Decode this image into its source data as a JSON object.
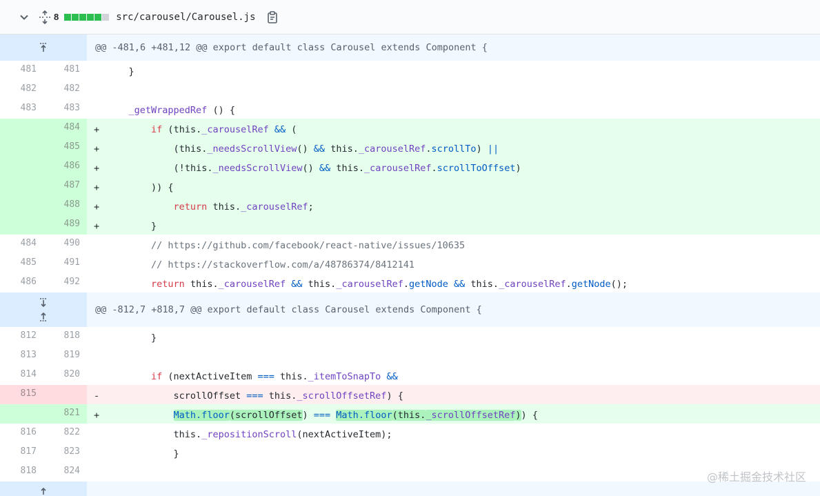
{
  "file": {
    "stat_count": "8",
    "stat_colors": [
      "#2cbe4e",
      "#2cbe4e",
      "#2cbe4e",
      "#2cbe4e",
      "#2cbe4e",
      "#d1d5da"
    ],
    "path": "src/carousel/Carousel.js",
    "icons": {
      "collapse": "chevron-down-icon",
      "expand": "unfold-icon",
      "copy": "clipboard-icon"
    }
  },
  "hunks": [
    {
      "header": "@@ -481,6 +481,12 @@ export default class Carousel extends Component {"
    },
    {
      "header": "@@ -812,7 +818,7 @@ export default class Carousel extends Component {"
    }
  ],
  "lines": [
    {
      "old": "481",
      "new": "481",
      "marker": ""
    },
    {
      "old": "482",
      "new": "482",
      "marker": ""
    },
    {
      "old": "483",
      "new": "483",
      "marker": ""
    },
    {
      "old": "",
      "new": "484",
      "marker": "+"
    },
    {
      "old": "",
      "new": "485",
      "marker": "+"
    },
    {
      "old": "",
      "new": "486",
      "marker": "+"
    },
    {
      "old": "",
      "new": "487",
      "marker": "+"
    },
    {
      "old": "",
      "new": "488",
      "marker": "+"
    },
    {
      "old": "",
      "new": "489",
      "marker": "+"
    },
    {
      "old": "484",
      "new": "490",
      "marker": ""
    },
    {
      "old": "485",
      "new": "491",
      "marker": ""
    },
    {
      "old": "486",
      "new": "492",
      "marker": ""
    },
    {
      "old": "812",
      "new": "818",
      "marker": ""
    },
    {
      "old": "813",
      "new": "819",
      "marker": ""
    },
    {
      "old": "814",
      "new": "820",
      "marker": ""
    },
    {
      "old": "815",
      "new": "",
      "marker": "-"
    },
    {
      "old": "",
      "new": "821",
      "marker": "+"
    },
    {
      "old": "816",
      "new": "822",
      "marker": ""
    },
    {
      "old": "817",
      "new": "823",
      "marker": ""
    },
    {
      "old": "818",
      "new": "824",
      "marker": ""
    }
  ],
  "code": {
    "l0": {
      "indent": "    ",
      "t": "}"
    },
    "l2": {
      "indent": "    ",
      "fn": "_getWrappedRef",
      "t": " () {"
    },
    "l3": {
      "indent": "        ",
      "kw": "if",
      "a": " (",
      "this": "this",
      "dot": ".",
      "fn": "_carouselRef",
      "op": " &&",
      "b": " ("
    },
    "l4": {
      "indent": "            ",
      "a": "(",
      "this1": "this",
      "d1": ".",
      "fn1": "_needsScrollView",
      "b": "() ",
      "op1": "&&",
      "c": " ",
      "this2": "this",
      "d2": ".",
      "fn2": "_carouselRef",
      "d3": ".",
      "prop": "scrollTo",
      "e": ") ",
      "op2": "||"
    },
    "l5": {
      "indent": "            ",
      "a": "(!",
      "this1": "this",
      "d1": ".",
      "fn1": "_needsScrollView",
      "b": "() ",
      "op1": "&&",
      "c": " ",
      "this2": "this",
      "d2": ".",
      "fn2": "_carouselRef",
      "d3": ".",
      "prop": "scrollToOffset",
      "e": ")"
    },
    "l6": {
      "indent": "        ",
      "t": ")) {"
    },
    "l7": {
      "indent": "            ",
      "kw": "return",
      "a": " ",
      "this": "this",
      "dot": ".",
      "fn": "_carouselRef",
      "b": ";"
    },
    "l8": {
      "indent": "        ",
      "t": "}"
    },
    "l9": {
      "indent": "        ",
      "cm": "// https://github.com/facebook/react-native/issues/10635"
    },
    "l10": {
      "indent": "        ",
      "cm": "// https://stackoverflow.com/a/48786374/8412141"
    },
    "l11": {
      "indent": "        ",
      "kw": "return",
      "a": " this.",
      "fn1": "_carouselRef",
      "op1": " &&",
      "b": " this.",
      "fn2": "_carouselRef",
      "c": ".",
      "prop1": "getNode",
      "op2": " &&",
      "d": " this.",
      "fn3": "_carouselRef",
      "e": ".",
      "prop2": "getNode",
      "f": "();"
    },
    "l12": {
      "indent": "        ",
      "t": "}"
    },
    "l14": {
      "indent": "        ",
      "kw": "if",
      "a": " (nextActiveItem ",
      "op1": "===",
      "b": " this.",
      "fn": "_itemToSnapTo",
      "op2": " &&"
    },
    "l15": {
      "indent": "            ",
      "a": "scrollOffset ",
      "op": "===",
      "b": " this.",
      "fn": "_scrollOffsetRef",
      "c": ") {"
    },
    "l16": {
      "indent": "            ",
      "m1": "Math.floor",
      "a1": "(scrollOffset",
      "a2": ")",
      "op": " ===",
      "sp": " ",
      "m2": "Math.floor",
      "b1": "(this.",
      "fn": "_scrollOffsetRef",
      "b2": ")",
      "b3": ")",
      "c": " {"
    },
    "l17": {
      "indent": "            ",
      "a": "this.",
      "fn": "_repositionScroll",
      "b": "(nextActiveItem);"
    },
    "l18": {
      "indent": "            ",
      "t": "}"
    }
  },
  "watermark": "@稀土掘金技术社区"
}
